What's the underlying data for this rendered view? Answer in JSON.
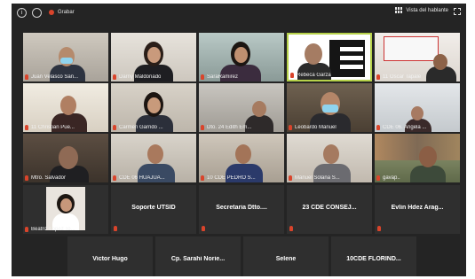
{
  "topbar": {
    "info_icon": "info-icon",
    "shield_icon": "shield-icon",
    "record_label": "Grabar",
    "speaker_view_label": "Vista del hablante",
    "fullscreen_icon": "fullscreen-icon"
  },
  "colors": {
    "active_border": "#b7d24a",
    "mic_muted": "#d9442b",
    "background": "#242424"
  },
  "video_tiles": [
    {
      "name": "Juan Velasco San..."
    },
    {
      "name": "Darny Maldonado"
    },
    {
      "name": "SaraRamirez"
    },
    {
      "name": "Rebeca Garza"
    },
    {
      "name": "11 Oscar Tapale"
    },
    {
      "name": "11 Christian Pue..."
    },
    {
      "name": "Carmen Garrido ..."
    },
    {
      "name": "Dto. 24 Edith Em..."
    },
    {
      "name": "Leobardo Manuel"
    },
    {
      "name": "CDE 06. Angela ..."
    },
    {
      "name": "Mtro. Salvador"
    },
    {
      "name": "CDE 06 HUAJUA..."
    },
    {
      "name": "10 CDE PEDRO S..."
    },
    {
      "name": "Manuel Solana S..."
    },
    {
      "name": "gavap.."
    },
    {
      "name": "Beatriz Lopez To..."
    }
  ],
  "name_tiles": [
    {
      "name": "Soporte UTSID"
    },
    {
      "name": "Secretaria Dtto...."
    },
    {
      "name": "23 CDE CONSEJ..."
    },
    {
      "name": "Evlin Hdez Arag..."
    },
    {
      "name": "Victor Hugo"
    },
    {
      "name": "Cp. Sarahi Norie..."
    },
    {
      "name": "Selene"
    },
    {
      "name": "10CDE FLORIND..."
    }
  ]
}
